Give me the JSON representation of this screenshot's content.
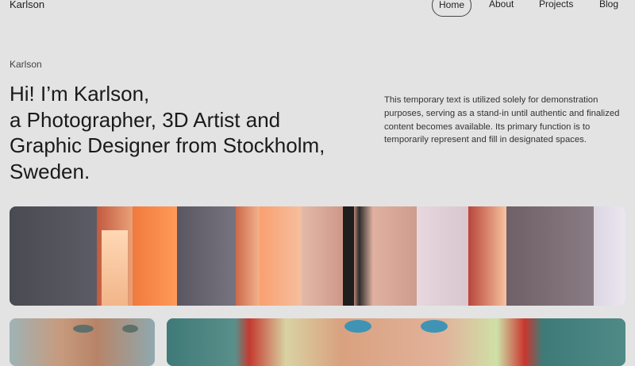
{
  "header": {
    "logo": "Karlson",
    "nav": [
      {
        "label": "Home",
        "active": true
      },
      {
        "label": "About",
        "active": false
      },
      {
        "label": "Projects",
        "active": false
      },
      {
        "label": "Blog",
        "active": false
      }
    ]
  },
  "hero": {
    "eyebrow": "Karlson",
    "headline_lines": [
      "Hi! I’m Karlson,",
      "a Photographer, 3D Artist and",
      "Graphic Designer from Stockholm,",
      "Sweden."
    ],
    "intro": "This temporary text is utilized solely for demonstration purposes, serving as a stand-in until authentic and finalized content becomes available. Its primary function is to temporarily represent and fill in designated spaces."
  },
  "colors": {
    "background": "#e3e3e3",
    "text": "#1d1d1d",
    "accent_orange": "#f08a4a"
  }
}
